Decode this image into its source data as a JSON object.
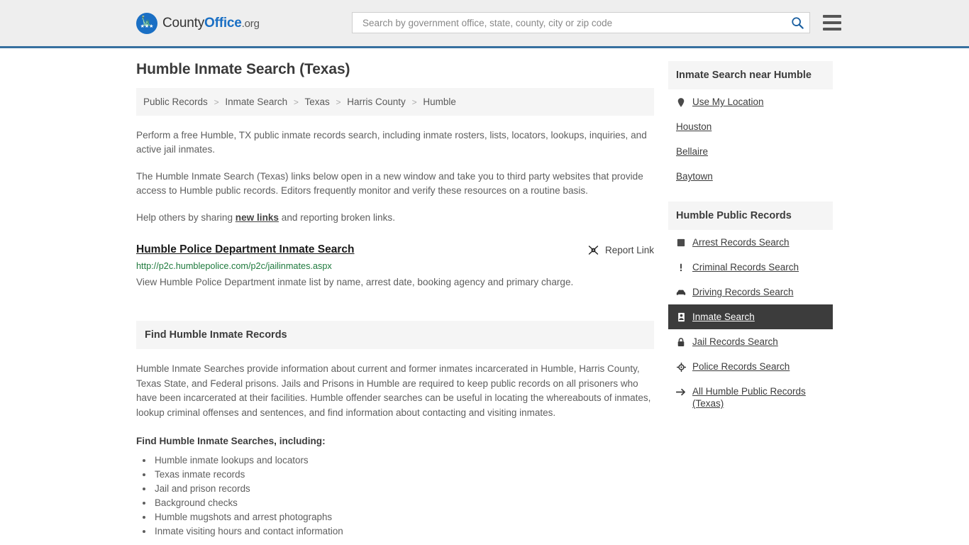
{
  "header": {
    "logo": {
      "word1": "County",
      "word2": "Office",
      "suffix": ".org",
      "icon": "eagle-seal-icon"
    },
    "search": {
      "placeholder": "Search by government office, state, county, city or zip code",
      "value": "",
      "icon": "search-icon"
    },
    "menu_icon": "hamburger-menu-icon"
  },
  "page": {
    "title": "Humble Inmate Search (Texas)"
  },
  "breadcrumb": {
    "separator": ">",
    "items": [
      {
        "label": "Public Records",
        "current": false
      },
      {
        "label": "Inmate Search",
        "current": false
      },
      {
        "label": "Texas",
        "current": false
      },
      {
        "label": "Harris County",
        "current": false
      },
      {
        "label": "Humble",
        "current": true
      }
    ]
  },
  "intro": {
    "p1": "Perform a free Humble, TX public inmate records search, including inmate rosters, lists, locators, lookups, inquiries, and active jail inmates.",
    "p2": "The Humble Inmate Search (Texas) links below open in a new window and take you to third party websites that provide access to Humble public records. Editors frequently monitor and verify these resources on a routine basis.",
    "p3_before": "Help others by sharing ",
    "p3_link": "new links",
    "p3_after": " and reporting broken links."
  },
  "result": {
    "title": "Humble Police Department Inmate Search",
    "url": "http://p2c.humblepolice.com/p2c/jailinmates.aspx",
    "description": "View Humble Police Department inmate list by name, arrest date, booking agency and primary charge.",
    "report_label": "Report Link",
    "report_icon": "broken-link-icon"
  },
  "section": {
    "heading": "Find Humble Inmate Records",
    "paragraph": "Humble Inmate Searches provide information about current and former inmates incarcerated in Humble, Harris County, Texas State, and Federal prisons. Jails and Prisons in Humble are required to keep public records on all prisoners who have been incarcerated at their facilities. Humble offender searches can be useful in locating the whereabouts of inmates, lookup criminal offenses and sentences, and find information about contacting and visiting inmates.",
    "sub_heading": "Find Humble Inmate Searches, including:",
    "bullets": [
      "Humble inmate lookups and locators",
      "Texas inmate records",
      "Jail and prison records",
      "Background checks",
      "Humble mugshots and arrest photographs",
      "Inmate visiting hours and contact information"
    ]
  },
  "sidebar": {
    "near": {
      "title": "Inmate Search near Humble",
      "items": [
        {
          "label": "Use My Location",
          "icon": "map-pin-icon",
          "active": false
        },
        {
          "label": "Houston",
          "icon": "",
          "active": false
        },
        {
          "label": "Bellaire",
          "icon": "",
          "active": false
        },
        {
          "label": "Baytown",
          "icon": "",
          "active": false
        }
      ]
    },
    "records": {
      "title": "Humble Public Records",
      "items": [
        {
          "label": "Arrest Records Search",
          "icon": "fingerprint-icon",
          "active": false
        },
        {
          "label": "Criminal Records Search",
          "icon": "exclamation-icon",
          "active": false
        },
        {
          "label": "Driving Records Search",
          "icon": "car-icon",
          "active": false
        },
        {
          "label": "Inmate Search",
          "icon": "id-card-icon",
          "active": true
        },
        {
          "label": "Jail Records Search",
          "icon": "padlock-icon",
          "active": false
        },
        {
          "label": "Police Records Search",
          "icon": "police-badge-icon",
          "active": false
        },
        {
          "label": "All Humble Public Records (Texas)",
          "icon": "arrow-right-icon",
          "active": false
        }
      ]
    }
  },
  "colors": {
    "brand_blue": "#1a6fc4",
    "header_border": "#37709f",
    "header_bg": "#eeeeee",
    "panel_bg": "#f5f5f5",
    "active_bg": "#3c3c3c",
    "url_green": "#1f7a3d"
  }
}
